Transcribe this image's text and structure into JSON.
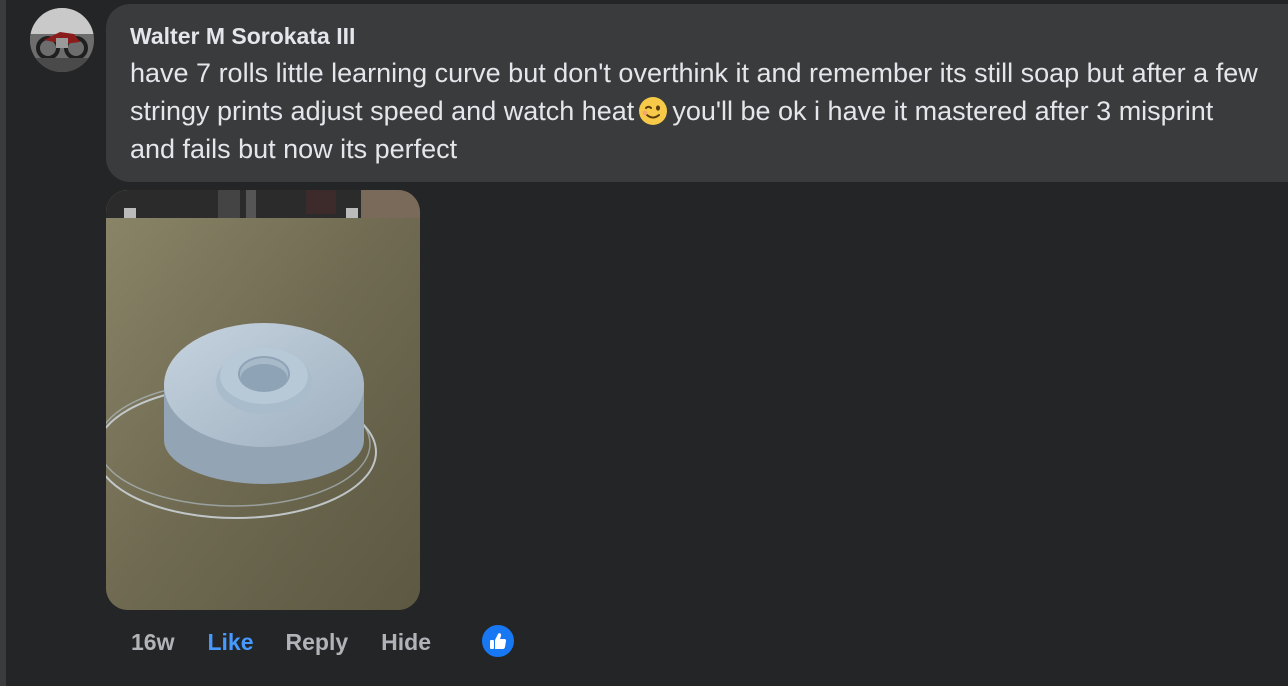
{
  "comment": {
    "author": "Walter M Sorokata III",
    "text_before_emoji": "have 7 rolls little learning curve but don't overthink it and remember its still soap but after a few stringy prints adjust speed and watch heat",
    "text_after_emoji": "you'll be ok i have it mastered after 3 misprint and fails but now its perfect",
    "emoji": "winking-face-emoji"
  },
  "actions": {
    "time": "16w",
    "like": "Like",
    "reply": "Reply",
    "hide": "Hide"
  },
  "reaction": {
    "icon": "thumbs-up-icon",
    "color": "#1877f2"
  },
  "colors": {
    "background": "#242526",
    "bubble": "#3a3b3c",
    "text": "#e4e6eb",
    "muted": "#b0b3b8",
    "like_active": "#4599ff"
  }
}
